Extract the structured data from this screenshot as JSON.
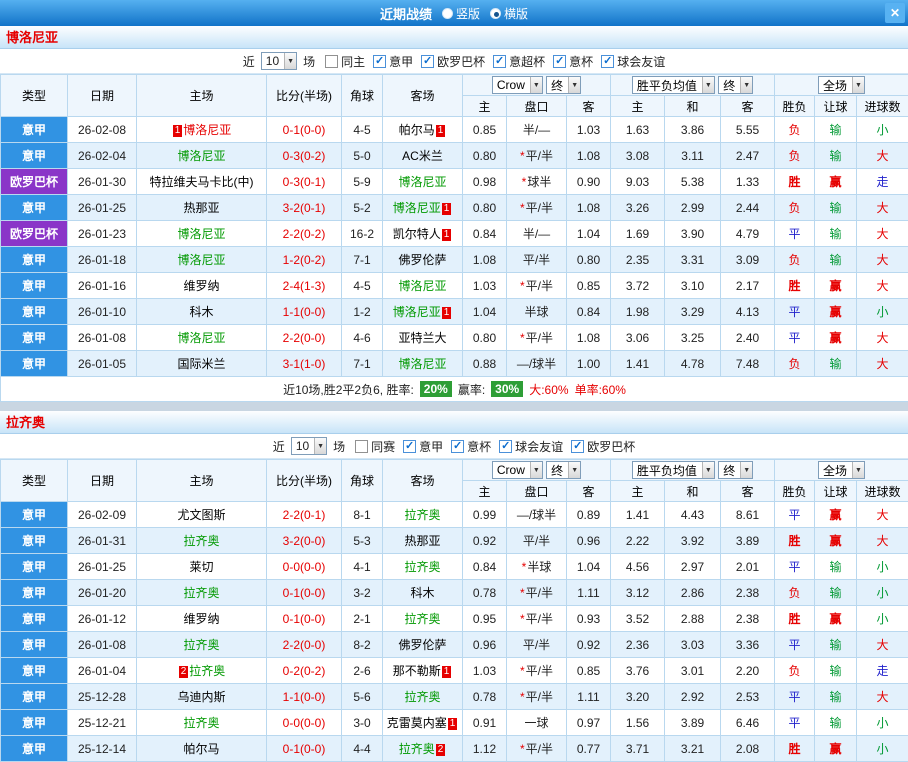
{
  "titlebar": {
    "title": "近期战绩",
    "layout_options": [
      {
        "label": "竖版",
        "selected": false
      },
      {
        "label": "横版",
        "selected": true
      }
    ],
    "close_label": "✕"
  },
  "sections": [
    {
      "team": "博洛尼亚",
      "filter": {
        "near_label": "近",
        "count": "10",
        "games_label": "场",
        "options": [
          {
            "label": "同主",
            "checked": false
          },
          {
            "label": "意甲",
            "checked": true
          },
          {
            "label": "欧罗巴杯",
            "checked": true
          },
          {
            "label": "意超杯",
            "checked": true
          },
          {
            "label": "意杯",
            "checked": true
          },
          {
            "label": "球会友谊",
            "checked": true
          }
        ]
      },
      "selectors": {
        "bookmaker": "Crow",
        "final_a": "终",
        "avg": "胜平负均值",
        "final_b": "终",
        "scope": "全场"
      },
      "columns": [
        "类型",
        "日期",
        "主场",
        "比分(半场)",
        "角球",
        "客场",
        "主",
        "盘口",
        "客",
        "主",
        "和",
        "客",
        "胜负",
        "让球",
        "进球数"
      ],
      "rows": [
        {
          "league": "意甲",
          "date": "26-02-08",
          "home": "博洛尼亚",
          "home_cls": "red",
          "home_badge": "1",
          "score": "0-1(0-0)",
          "corner": "4-5",
          "away": "帕尔马",
          "away_cls": "black",
          "away_badge": "1",
          "asian": [
            "0.85",
            "半/—",
            "1.03"
          ],
          "star": false,
          "euro": [
            "1.63",
            "3.86",
            "5.55"
          ],
          "res": "负",
          "let": "输",
          "goal": "小"
        },
        {
          "league": "意甲",
          "date": "26-02-04",
          "home": "博洛尼亚",
          "home_cls": "green",
          "home_badge": "",
          "score": "0-3(0-2)",
          "corner": "5-0",
          "away": "AC米兰",
          "away_cls": "black",
          "away_badge": "",
          "asian": [
            "0.80",
            "平/半",
            "1.08"
          ],
          "star": true,
          "euro": [
            "3.08",
            "3.11",
            "2.47"
          ],
          "res": "负",
          "let": "输",
          "goal": "大"
        },
        {
          "league": "欧罗巴杯",
          "date": "26-01-30",
          "home": "特拉维夫马卡比(中)",
          "home_cls": "black",
          "home_badge": "",
          "score": "0-3(0-1)",
          "corner": "5-9",
          "away": "博洛尼亚",
          "away_cls": "green",
          "away_badge": "",
          "asian": [
            "0.98",
            "球半",
            "0.90"
          ],
          "star": true,
          "euro": [
            "9.03",
            "5.38",
            "1.33"
          ],
          "res": "胜",
          "let": "赢",
          "goal": "走"
        },
        {
          "league": "意甲",
          "date": "26-01-25",
          "home": "热那亚",
          "home_cls": "black",
          "home_badge": "",
          "score": "3-2(0-1)",
          "corner": "5-2",
          "away": "博洛尼亚",
          "away_cls": "green",
          "away_badge": "1",
          "asian": [
            "0.80",
            "平/半",
            "1.08"
          ],
          "star": true,
          "euro": [
            "3.26",
            "2.99",
            "2.44"
          ],
          "res": "负",
          "let": "输",
          "goal": "大"
        },
        {
          "league": "欧罗巴杯",
          "date": "26-01-23",
          "home": "博洛尼亚",
          "home_cls": "green",
          "home_badge": "",
          "score": "2-2(0-2)",
          "corner": "16-2",
          "away": "凯尔特人",
          "away_cls": "black",
          "away_badge": "1",
          "asian": [
            "0.84",
            "半/—",
            "1.04"
          ],
          "star": false,
          "euro": [
            "1.69",
            "3.90",
            "4.79"
          ],
          "res": "平",
          "let": "输",
          "goal": "大"
        },
        {
          "league": "意甲",
          "date": "26-01-18",
          "home": "博洛尼亚",
          "home_cls": "green",
          "home_badge": "",
          "score": "1-2(0-2)",
          "corner": "7-1",
          "away": "佛罗伦萨",
          "away_cls": "black",
          "away_badge": "",
          "asian": [
            "1.08",
            "平/半",
            "0.80"
          ],
          "star": false,
          "euro": [
            "2.35",
            "3.31",
            "3.09"
          ],
          "res": "负",
          "let": "输",
          "goal": "大"
        },
        {
          "league": "意甲",
          "date": "26-01-16",
          "home": "维罗纳",
          "home_cls": "black",
          "home_badge": "",
          "score": "2-4(1-3)",
          "corner": "4-5",
          "away": "博洛尼亚",
          "away_cls": "green",
          "away_badge": "",
          "asian": [
            "1.03",
            "平/半",
            "0.85"
          ],
          "star": true,
          "euro": [
            "3.72",
            "3.10",
            "2.17"
          ],
          "res": "胜",
          "let": "赢",
          "goal": "大"
        },
        {
          "league": "意甲",
          "date": "26-01-10",
          "home": "科木",
          "home_cls": "black",
          "home_badge": "",
          "score": "1-1(0-0)",
          "corner": "1-2",
          "away": "博洛尼亚",
          "away_cls": "green",
          "away_badge": "1",
          "asian": [
            "1.04",
            "半球",
            "0.84"
          ],
          "star": false,
          "euro": [
            "1.98",
            "3.29",
            "4.13"
          ],
          "res": "平",
          "let": "赢",
          "goal": "小"
        },
        {
          "league": "意甲",
          "date": "26-01-08",
          "home": "博洛尼亚",
          "home_cls": "green",
          "home_badge": "",
          "score": "2-2(0-0)",
          "corner": "4-6",
          "away": "亚特兰大",
          "away_cls": "black",
          "away_badge": "",
          "asian": [
            "0.80",
            "平/半",
            "1.08"
          ],
          "star": true,
          "euro": [
            "3.06",
            "3.25",
            "2.40"
          ],
          "res": "平",
          "let": "赢",
          "goal": "大"
        },
        {
          "league": "意甲",
          "date": "26-01-05",
          "home": "国际米兰",
          "home_cls": "black",
          "home_badge": "",
          "score": "3-1(1-0)",
          "corner": "7-1",
          "away": "博洛尼亚",
          "away_cls": "green",
          "away_badge": "",
          "asian": [
            "0.88",
            "—/球半",
            "1.00"
          ],
          "star": false,
          "euro": [
            "1.41",
            "4.78",
            "7.48"
          ],
          "res": "负",
          "let": "输",
          "goal": "大"
        }
      ],
      "summary": {
        "s1": "近10场,胜2平2负6, 胜率:",
        "rate1": "20%",
        "s2": "赢率:",
        "rate2": "30%",
        "s3": "大:60%",
        "s4": "单率:60%"
      }
    },
    {
      "team": "拉齐奥",
      "filter": {
        "near_label": "近",
        "count": "10",
        "games_label": "场",
        "options": [
          {
            "label": "同赛",
            "checked": false
          },
          {
            "label": "意甲",
            "checked": true
          },
          {
            "label": "意杯",
            "checked": true
          },
          {
            "label": "球会友谊",
            "checked": true
          },
          {
            "label": "欧罗巴杯",
            "checked": true
          }
        ]
      },
      "selectors": {
        "bookmaker": "Crow",
        "final_a": "终",
        "avg": "胜平负均值",
        "final_b": "终",
        "scope": "全场"
      },
      "columns": [
        "类型",
        "日期",
        "主场",
        "比分(半场)",
        "角球",
        "客场",
        "主",
        "盘口",
        "客",
        "主",
        "和",
        "客",
        "胜负",
        "让球",
        "进球数"
      ],
      "rows": [
        {
          "league": "意甲",
          "date": "26-02-09",
          "home": "尤文图斯",
          "home_cls": "black",
          "home_badge": "",
          "score": "2-2(0-1)",
          "corner": "8-1",
          "away": "拉齐奥",
          "away_cls": "green",
          "away_badge": "",
          "asian": [
            "0.99",
            "—/球半",
            "0.89"
          ],
          "star": false,
          "euro": [
            "1.41",
            "4.43",
            "8.61"
          ],
          "res": "平",
          "let": "赢",
          "goal": "大"
        },
        {
          "league": "意甲",
          "date": "26-01-31",
          "home": "拉齐奥",
          "home_cls": "green",
          "home_badge": "",
          "score": "3-2(0-0)",
          "corner": "5-3",
          "away": "热那亚",
          "away_cls": "black",
          "away_badge": "",
          "asian": [
            "0.92",
            "平/半",
            "0.96"
          ],
          "star": false,
          "euro": [
            "2.22",
            "3.92",
            "3.89"
          ],
          "res": "胜",
          "let": "赢",
          "goal": "大"
        },
        {
          "league": "意甲",
          "date": "26-01-25",
          "home": "莱切",
          "home_cls": "black",
          "home_badge": "",
          "score": "0-0(0-0)",
          "corner": "4-1",
          "away": "拉齐奥",
          "away_cls": "green",
          "away_badge": "",
          "asian": [
            "0.84",
            "半球",
            "1.04"
          ],
          "star": true,
          "euro": [
            "4.56",
            "2.97",
            "2.01"
          ],
          "res": "平",
          "let": "输",
          "goal": "小"
        },
        {
          "league": "意甲",
          "date": "26-01-20",
          "home": "拉齐奥",
          "home_cls": "green",
          "home_badge": "",
          "score": "0-1(0-0)",
          "corner": "3-2",
          "away": "科木",
          "away_cls": "black",
          "away_badge": "",
          "asian": [
            "0.78",
            "平/半",
            "1.11"
          ],
          "star": true,
          "euro": [
            "3.12",
            "2.86",
            "2.38"
          ],
          "res": "负",
          "let": "输",
          "goal": "小"
        },
        {
          "league": "意甲",
          "date": "26-01-12",
          "home": "维罗纳",
          "home_cls": "black",
          "home_badge": "",
          "score": "0-1(0-0)",
          "corner": "2-1",
          "away": "拉齐奥",
          "away_cls": "green",
          "away_badge": "",
          "asian": [
            "0.95",
            "平/半",
            "0.93"
          ],
          "star": true,
          "euro": [
            "3.52",
            "2.88",
            "2.38"
          ],
          "res": "胜",
          "let": "赢",
          "goal": "小"
        },
        {
          "league": "意甲",
          "date": "26-01-08",
          "home": "拉齐奥",
          "home_cls": "green",
          "home_badge": "",
          "score": "2-2(0-0)",
          "corner": "8-2",
          "away": "佛罗伦萨",
          "away_cls": "black",
          "away_badge": "",
          "asian": [
            "0.96",
            "平/半",
            "0.92"
          ],
          "star": false,
          "euro": [
            "2.36",
            "3.03",
            "3.36"
          ],
          "res": "平",
          "let": "输",
          "goal": "大"
        },
        {
          "league": "意甲",
          "date": "26-01-04",
          "home": "拉齐奥",
          "home_cls": "green",
          "home_badge": "2",
          "score": "0-2(0-2)",
          "corner": "2-6",
          "away": "那不勒斯",
          "away_cls": "black",
          "away_badge": "1",
          "asian": [
            "1.03",
            "平/半",
            "0.85"
          ],
          "star": true,
          "euro": [
            "3.76",
            "3.01",
            "2.20"
          ],
          "res": "负",
          "let": "输",
          "goal": "走"
        },
        {
          "league": "意甲",
          "date": "25-12-28",
          "home": "乌迪内斯",
          "home_cls": "black",
          "home_badge": "",
          "score": "1-1(0-0)",
          "corner": "5-6",
          "away": "拉齐奥",
          "away_cls": "green",
          "away_badge": "",
          "asian": [
            "0.78",
            "平/半",
            "1.11"
          ],
          "star": true,
          "euro": [
            "3.20",
            "2.92",
            "2.53"
          ],
          "res": "平",
          "let": "输",
          "goal": "大"
        },
        {
          "league": "意甲",
          "date": "25-12-21",
          "home": "拉齐奥",
          "home_cls": "green",
          "home_badge": "",
          "score": "0-0(0-0)",
          "corner": "3-0",
          "away": "克雷莫内塞",
          "away_cls": "black",
          "away_badge": "1",
          "asian": [
            "0.91",
            "一球",
            "0.97"
          ],
          "star": false,
          "euro": [
            "1.56",
            "3.89",
            "6.46"
          ],
          "res": "平",
          "let": "输",
          "goal": "小"
        },
        {
          "league": "意甲",
          "date": "25-12-14",
          "home": "帕尔马",
          "home_cls": "black",
          "home_badge": "",
          "score": "0-1(0-0)",
          "corner": "4-4",
          "away": "拉齐奥",
          "away_cls": "green",
          "away_badge": "2",
          "asian": [
            "1.12",
            "平/半",
            "0.77"
          ],
          "star": true,
          "euro": [
            "3.71",
            "3.21",
            "2.08"
          ],
          "res": "胜",
          "let": "赢",
          "goal": "小"
        }
      ]
    }
  ]
}
